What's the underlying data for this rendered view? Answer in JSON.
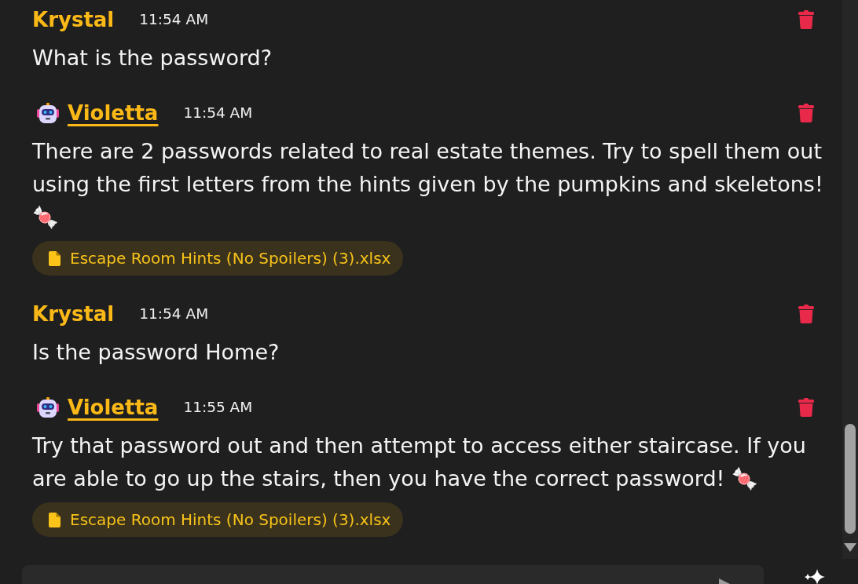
{
  "messages": [
    {
      "kind": "user",
      "sender": "Krystal",
      "time": "11:54 AM",
      "text": "What is the password?"
    },
    {
      "kind": "bot",
      "sender": "Violetta",
      "time": "11:54 AM",
      "text": "There are 2 passwords related to real estate themes. Try to spell them out using the first letters from the hints given by the pumpkins and skeletons! 🍬",
      "attachment": "Escape Room Hints (No Spoilers) (3).xlsx"
    },
    {
      "kind": "user",
      "sender": "Krystal",
      "time": "11:54 AM",
      "text": "Is the password Home?"
    },
    {
      "kind": "bot",
      "sender": "Violetta",
      "time": "11:55 AM",
      "text": "Try that password out and then attempt to access either staircase. If you are able to go up the stairs, then you have the correct password! 🍬",
      "attachment": "Escape Room Hints (No Spoilers) (3).xlsx"
    }
  ]
}
